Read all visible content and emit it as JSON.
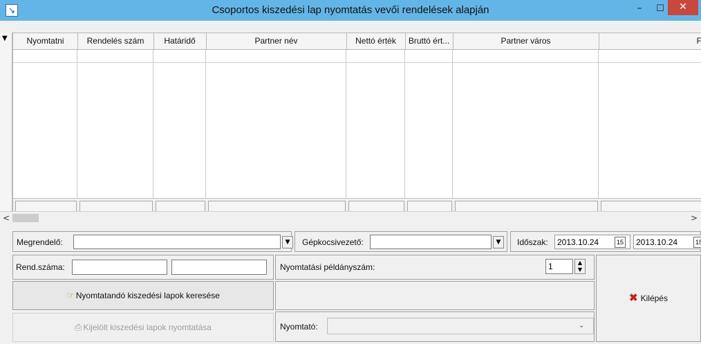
{
  "window": {
    "title": "Csoportos kiszedési lap nyomtatás vevői rendelések alapján",
    "min_glyph": "–",
    "max_glyph": "☐",
    "close_glyph": "✕"
  },
  "grid": {
    "columns": [
      "Nyomtatni",
      "Rendelés szám",
      "Határidő",
      "Partner név",
      "Nettó érték",
      "Bruttó ért...",
      "Partner város",
      "F"
    ]
  },
  "filters": {
    "customer_label": "Megrendelő:",
    "customer_value": "",
    "driver_label": "Gépkocsivezető:",
    "driver_value": "",
    "period_label": "Időszak:",
    "date_from": "2013.10.24",
    "date_to": "2013.10.24",
    "calendar_glyph": "15"
  },
  "order": {
    "label": "Rend.száma:",
    "from_value": "",
    "to_value": ""
  },
  "print": {
    "copies_label": "Nyomtatási példányszám:",
    "copies_value": "1",
    "printer_label": "Nyomtató:",
    "printer_value": ""
  },
  "buttons": {
    "search_label": "Nyomtatandó kiszedési lapok keresése",
    "print_label": "Kijelölt kiszedési lapok nyomtatása",
    "exit_label": "Kilépés"
  },
  "icons": {
    "app": "app-icon",
    "search": "pointing-hand-icon",
    "print": "printer-icon",
    "exit": "red-x-icon"
  },
  "colors": {
    "titlebar": "#64b5e7",
    "close_button": "#c9483d",
    "exit_icon": "#c0281c"
  }
}
